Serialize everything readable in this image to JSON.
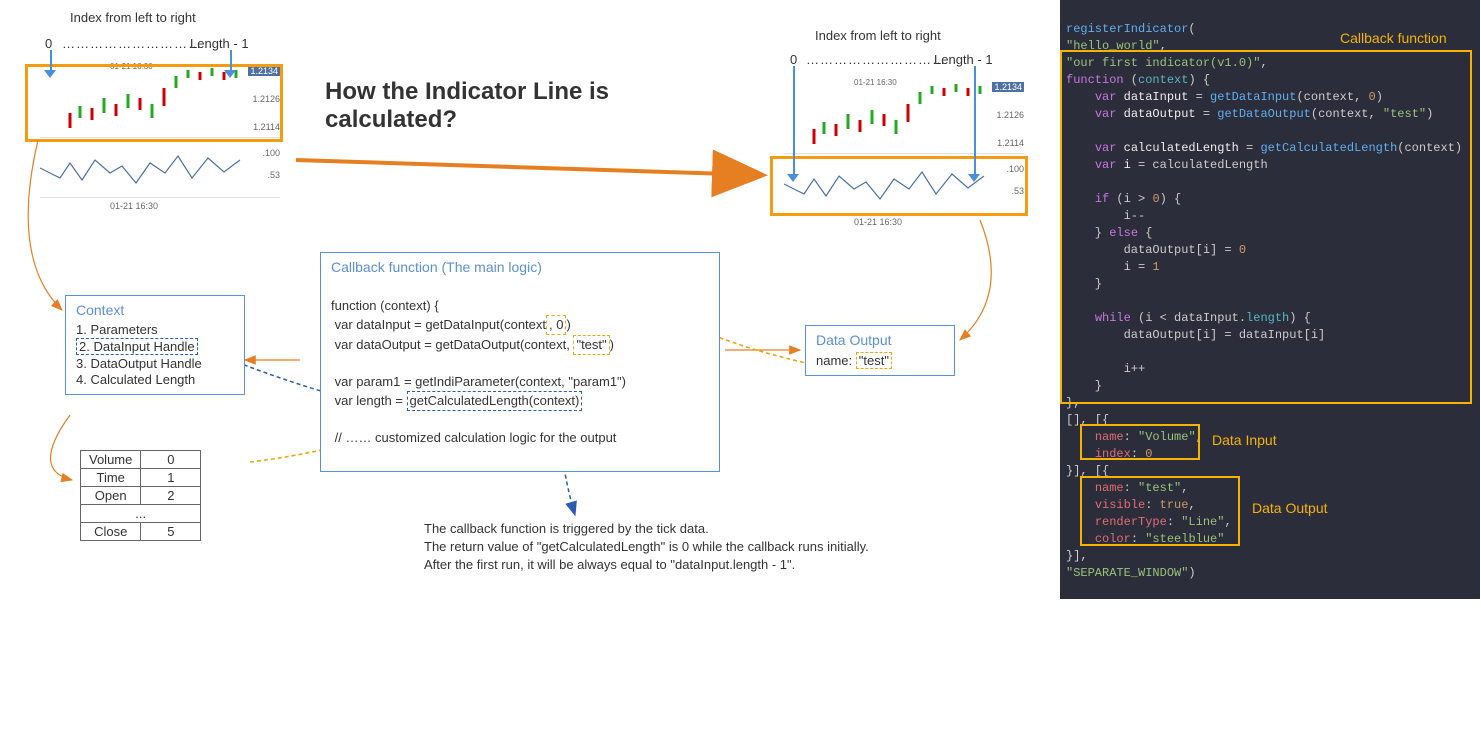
{
  "index_label": "Index from left to right",
  "index_start": "0",
  "index_end": "Length - 1",
  "title": "How the Indicator Line is calculated?",
  "chart": {
    "timestamp": "01-21 16:30",
    "top_ticks": [
      "1.2134",
      "1.2126",
      "1.2114"
    ],
    "bot_ticks": [
      ".100",
      ".53"
    ]
  },
  "context": {
    "title": "Context",
    "items": [
      "1. Parameters",
      "2. DataInput Handle",
      "3. DataOutput Handle",
      "4. Calculated Length"
    ]
  },
  "callback": {
    "title": "Callback function (The main logic)",
    "l1": "function (context) {",
    "l2a": " var dataInput = getDataInput(context",
    "l2b": ", 0",
    "l2c": ")",
    "l3a": " var dataOutput = getDataOutput(context, ",
    "l3b": "\"test\"",
    "l3c": ")",
    "l4": "",
    "l5a": " var param1 = getIndiParameter(context, \"param1\")",
    "l6a": " var length = ",
    "l6b": "getCalculatedLength(context)",
    "l7": "",
    "l8": " // …… customized calculation logic for the output"
  },
  "data_output_box": {
    "title": "Data Output",
    "label_key": "name:",
    "label_val": "\"test\""
  },
  "vol_table": {
    "rows": [
      [
        "Volume",
        "0"
      ],
      [
        "Time",
        "1"
      ],
      [
        "Open",
        "2"
      ],
      [
        "...",
        ""
      ],
      [
        "Close",
        "5"
      ]
    ]
  },
  "notes": {
    "l1": "The callback function is triggered by the tick data.",
    "l2": "The return value of \"getCalculatedLength\" is 0 while the callback runs initially.",
    "l3": "After the first run, it will be always equal to \"dataInput.length - 1\"."
  },
  "code": {
    "register": "registerIndicator(",
    "name": "\"hello_world\",",
    "desc": "\"our first indicator(v1.0)\",",
    "fn_open": "function (context) {",
    "di": "    var dataInput = getDataInput(context, 0)",
    "do": "    var dataOutput = getDataOutput(context, \"test\")",
    "cl": "    var calculatedLength = getCalculatedLength(context)",
    "vi": "    var i = calculatedLength",
    "if": "    if (i > 0) {",
    "ifb": "        i--",
    "else": "    } else {",
    "elb1": "        dataOutput[i] = 0",
    "elb2": "        i = 1",
    "cb": "    }",
    "wh": "    while (i < dataInput.length) {",
    "whb": "        dataOutput[i] = dataInput[i]",
    "ipp": "        i++",
    "fn_close": "},",
    "in_open": "[], [{",
    "in_name": "    name: \"Volume\",",
    "in_index": "    index: 0",
    "in_close": "}], [{",
    "out_name": "    name: \"test\",",
    "out_vis": "    visible: true,",
    "out_rt": "    renderType: \"Line\",",
    "out_col": "    color: \"steelblue\"",
    "out_close": "}],",
    "sep": "\"SEPARATE_WINDOW\")"
  },
  "callouts": {
    "callback": "Callback function",
    "data_input": "Data Input",
    "data_output": "Data Output"
  }
}
